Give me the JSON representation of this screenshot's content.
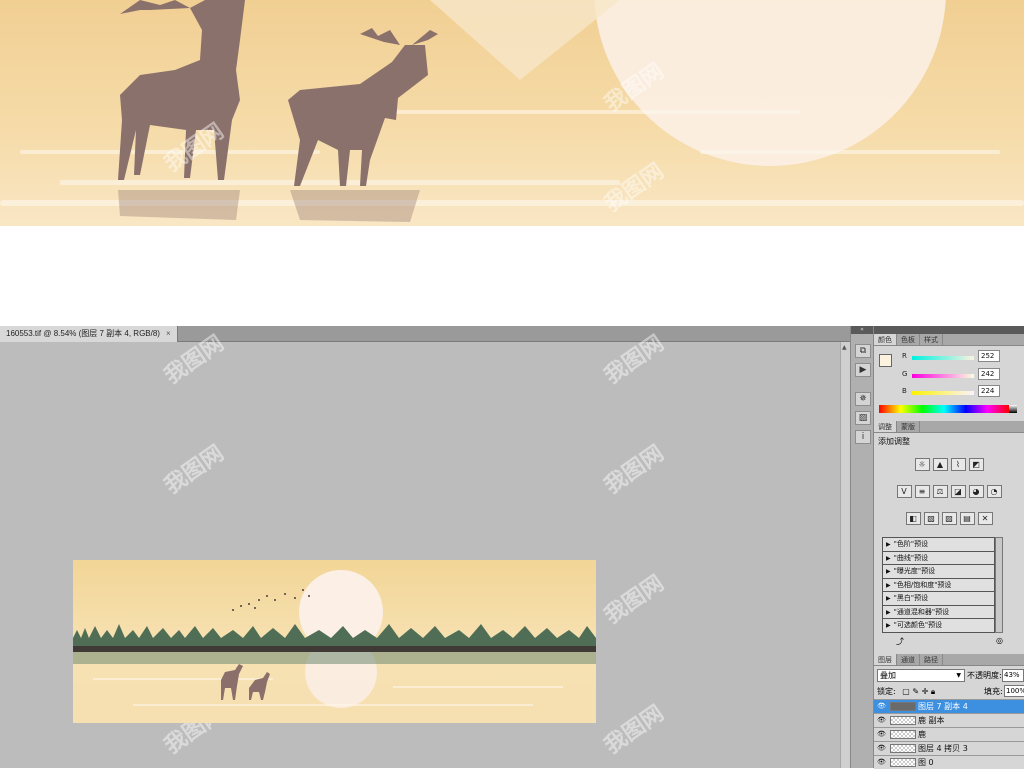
{
  "document": {
    "tab_title": "160553.tif @ 8.54% (图层 7 副本 4, RGB/8)",
    "close_glyph": "×"
  },
  "color_panel": {
    "tabs": [
      "颜色",
      "色板",
      "样式"
    ],
    "r_label": "R",
    "g_label": "G",
    "b_label": "B",
    "r": "252",
    "g": "242",
    "b": "224",
    "foreground": "#fcf2e0"
  },
  "adjustments_panel": {
    "tabs": [
      "调整",
      "蒙版"
    ],
    "title": "添加调整",
    "presets": [
      "\"色阶\"预设",
      "\"曲线\"预设",
      "\"曝光度\"预设",
      "\"色相/饱和度\"预设",
      "\"黑白\"预设",
      "\"通道混和器\"预设",
      "\"可选颜色\"预设"
    ]
  },
  "layers_panel": {
    "tabs": [
      "图层",
      "通道",
      "路径"
    ],
    "blend_mode": "叠加",
    "opacity_label": "不透明度:",
    "opacity": "43%",
    "lock_label": "锁定:",
    "fill_label": "填充:",
    "fill": "100%",
    "layers": [
      {
        "name": "图层 7 副本 4",
        "selected": true
      },
      {
        "name": "鹿 副本",
        "selected": false
      },
      {
        "name": "鹿",
        "selected": false
      },
      {
        "name": "图层 4 拷贝 3",
        "selected": false
      },
      {
        "name": "图 0",
        "selected": false
      }
    ]
  },
  "watermark": "我图网",
  "colors": {
    "sky_warm": "#f3d59e",
    "sun_pale": "#fbeee2",
    "deer_brown": "#8a6f6a",
    "forest_dark": "#3f3a35",
    "forest_green": "#4f7a5a",
    "selection_blue": "#3d8fe0",
    "ps_gray": "#bcbcbc"
  }
}
